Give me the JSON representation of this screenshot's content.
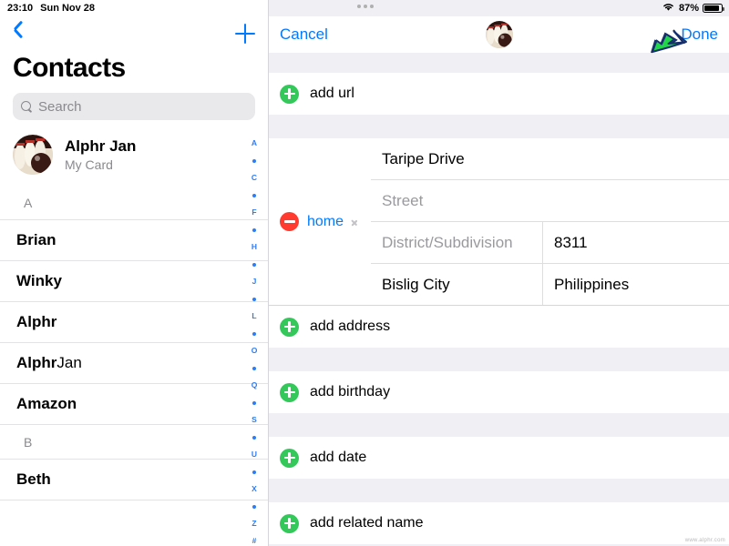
{
  "status_bar": {
    "time": "23:10",
    "date": "Sun Nov 28",
    "wifi_icon": "wifi-icon",
    "battery_percent": "87%",
    "battery_icon": "battery-full-icon",
    "multitask_handle": "multitask-dots"
  },
  "sidebar": {
    "back_icon": "chevron-left-icon",
    "add_icon": "plus-icon",
    "title": "Contacts",
    "search": {
      "placeholder": "Search",
      "icon": "search-icon"
    },
    "my_card": {
      "name": "Alphr Jan",
      "subtitle": "My Card",
      "avatar": "bowling-avatar"
    },
    "list": [
      {
        "kind": "section",
        "label": "A"
      },
      {
        "kind": "contact",
        "bold": "Brian",
        "regular": ""
      },
      {
        "kind": "contact",
        "bold": "Winky",
        "regular": ""
      },
      {
        "kind": "contact",
        "bold": "Alphr",
        "regular": ""
      },
      {
        "kind": "contact",
        "bold": "Alphr",
        "regular": " Jan"
      },
      {
        "kind": "contact",
        "bold": "Amazon",
        "regular": ""
      },
      {
        "kind": "section",
        "label": "B"
      },
      {
        "kind": "contact",
        "bold": "Beth",
        "regular": ""
      }
    ],
    "index": [
      "A",
      "•",
      "C",
      "•",
      "F",
      "•",
      "H",
      "•",
      "J",
      "•",
      "L",
      "•",
      "O",
      "•",
      "Q",
      "•",
      "S",
      "•",
      "U",
      "•",
      "X",
      "•",
      "Z",
      "#"
    ]
  },
  "detail": {
    "cancel_label": "Cancel",
    "done_label": "Done",
    "avatar": "bowling-avatar",
    "cursor_icon": "arrow-cursor-icon",
    "rows": {
      "add_url": "add url",
      "add_address": "add address",
      "add_birthday": "add birthday",
      "add_date": "add date",
      "add_related_name": "add related name"
    },
    "address": {
      "delete_icon": "minus-circle-icon",
      "type_label": "home",
      "chevron_icon": "chevron-right-icon",
      "street1_value": "Taripe Drive",
      "street2_placeholder": "Street",
      "district_placeholder": "District/Subdivision",
      "zip_value": "8311",
      "city_value": "Bislig City",
      "country_value": "Philippines"
    }
  },
  "colors": {
    "accent_blue": "#007aff",
    "green": "#34c759",
    "red": "#ff3b30",
    "group_bg": "#efeff4"
  }
}
